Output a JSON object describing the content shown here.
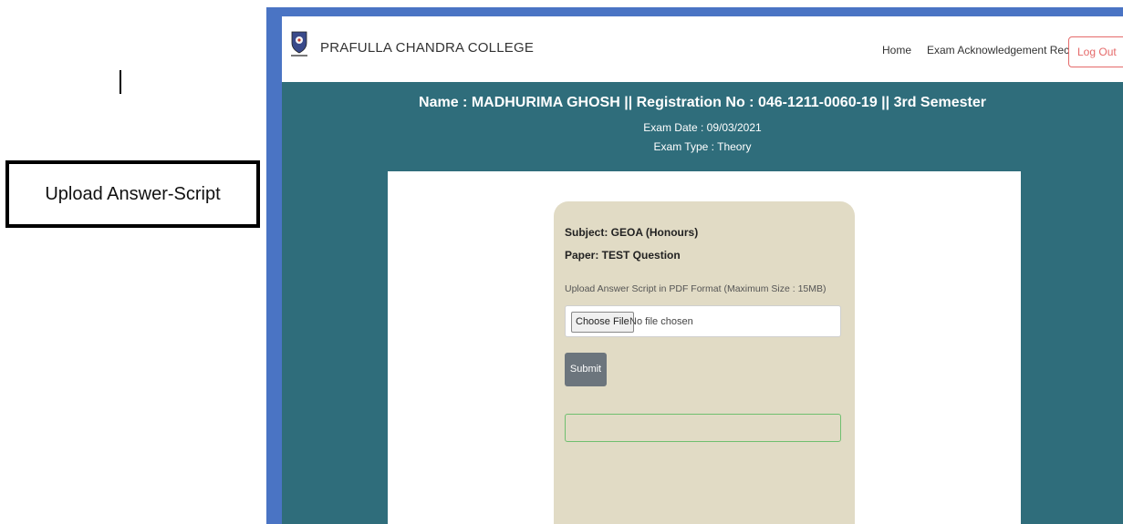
{
  "annotation": {
    "label": "Upload Answer-Script"
  },
  "navbar": {
    "brand": "PRAFULLA CHANDRA COLLEGE",
    "links": [
      "Home",
      "Exam Acknowledgement Receipt"
    ],
    "logout_label": "Log Out"
  },
  "student": {
    "heading": "Name : MADHURIMA GHOSH || Registration No : 046-1211-0060-19 || 3rd Semester",
    "exam_date": "Exam Date : 09/03/2021",
    "exam_type": "Exam Type : Theory"
  },
  "upload_form": {
    "subject": "Subject: GEOA (Honours)",
    "paper": "Paper: TEST Question",
    "instruction": "Upload Answer Script in PDF Format (Maximum Size : 15MB)",
    "choose_file_label": "Choose File",
    "no_file_text": "No file chosen",
    "submit_label": "Submit"
  },
  "colors": {
    "header_band": "#2f6d7b",
    "screenshot_border": "#4a74c4",
    "card_bg": "#e1dbc5",
    "logout": "#e56a6a",
    "submit_bg": "#6c757d",
    "status_border": "#6fbf6f"
  }
}
